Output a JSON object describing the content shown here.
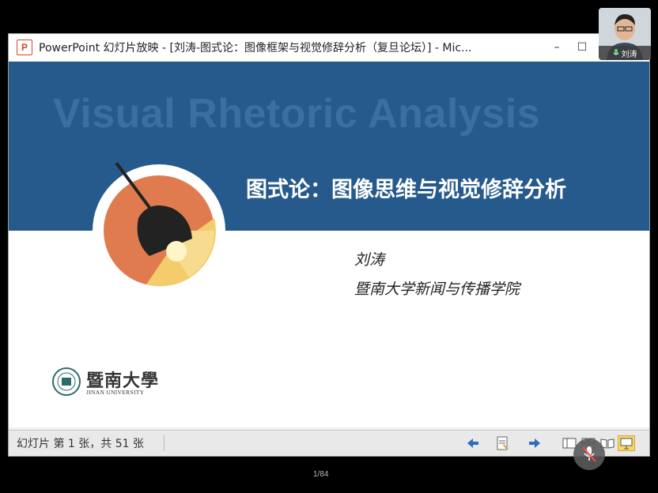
{
  "window": {
    "icon_letter": "P",
    "title": "PowerPoint 幻灯片放映 - [刘涛-图式论：图像框架与视觉修辞分析（复旦论坛）] - Mic...",
    "minimize": "–",
    "maximize": "☐"
  },
  "slide": {
    "background_title": "Visual Rhetoric Analysis",
    "title": "图式论：图像思维与视觉修辞分析",
    "author": "刘涛",
    "affiliation": "暨南大学新闻与传播学院",
    "logo_cn": "暨南大學",
    "logo_en": "JINAN UNIVERSITY",
    "colors": {
      "banner": "#265a8c",
      "lamp_circle": "#e07b4f",
      "lamp_light": "#f4cc6b"
    }
  },
  "statusbar": {
    "slide_info": "幻灯片 第 1 张，共 51 张",
    "buttons": [
      "prev-icon",
      "notes-icon",
      "next-icon",
      "normal-view-icon",
      "sorter-view-icon",
      "reading-view-icon",
      "slideshow-view-icon"
    ]
  },
  "meeting": {
    "participant_name": "刘涛",
    "page_counter": "1/84"
  }
}
